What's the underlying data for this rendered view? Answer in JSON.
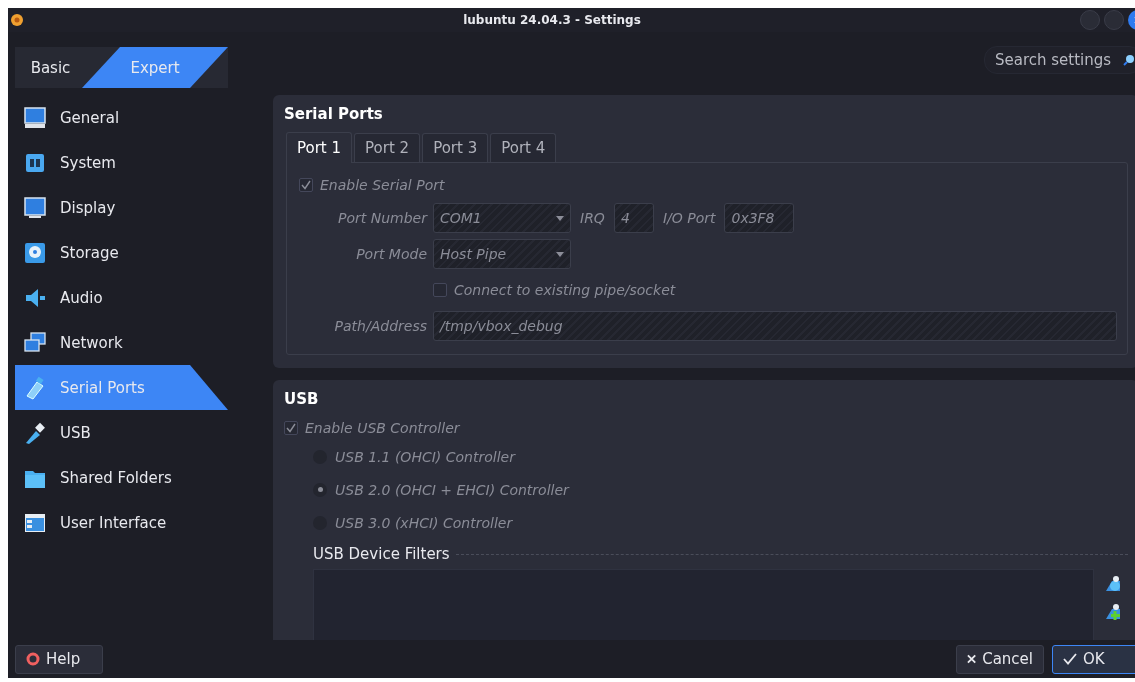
{
  "window": {
    "title": "lubuntu 24.04.3 - Settings"
  },
  "mode_tabs": [
    {
      "label": "Basic",
      "selected": false
    },
    {
      "label": "Expert",
      "selected": true
    }
  ],
  "search": {
    "placeholder": "Search settings"
  },
  "sidebar": {
    "items": [
      {
        "label": "General",
        "selected": false
      },
      {
        "label": "System",
        "selected": false
      },
      {
        "label": "Display",
        "selected": false
      },
      {
        "label": "Storage",
        "selected": false
      },
      {
        "label": "Audio",
        "selected": false
      },
      {
        "label": "Network",
        "selected": false
      },
      {
        "label": "Serial Ports",
        "selected": true
      },
      {
        "label": "USB",
        "selected": false
      },
      {
        "label": "Shared Folders",
        "selected": false
      },
      {
        "label": "User Interface",
        "selected": false
      }
    ]
  },
  "serial_ports": {
    "title": "Serial Ports",
    "disabled": true,
    "tabs": [
      {
        "label": "Port 1",
        "selected": true
      },
      {
        "label": "Port 2",
        "selected": false
      },
      {
        "label": "Port 3",
        "selected": false
      },
      {
        "label": "Port 4",
        "selected": false
      }
    ],
    "enable": {
      "label": "Enable Serial Port",
      "checked": true
    },
    "port_number": {
      "label": "Port Number",
      "value": "COM1"
    },
    "irq": {
      "label": "IRQ",
      "value": "4"
    },
    "io_port": {
      "label": "I/O Port",
      "value": "0x3F8"
    },
    "port_mode": {
      "label": "Port Mode",
      "value": "Host Pipe"
    },
    "connect": {
      "label": "Connect to existing pipe/socket",
      "checked": false
    },
    "path": {
      "label": "Path/Address",
      "value": "/tmp/vbox_debug"
    }
  },
  "usb": {
    "title": "USB",
    "disabled": true,
    "enable": {
      "label": "Enable USB Controller",
      "checked": true
    },
    "controllers": [
      {
        "label": "USB 1.1 (OHCI) Controller",
        "selected": false
      },
      {
        "label": "USB 2.0 (OHCI + EHCI) Controller",
        "selected": true
      },
      {
        "label": "USB 3.0 (xHCI) Controller",
        "selected": false
      }
    ],
    "filters": {
      "title": "USB Device Filters"
    }
  },
  "buttons": [
    {
      "label": "Help",
      "kind": "help",
      "default": false
    },
    {
      "label": "Cancel",
      "kind": "cancel",
      "default": false
    },
    {
      "label": "OK",
      "kind": "ok",
      "default": true
    }
  ]
}
